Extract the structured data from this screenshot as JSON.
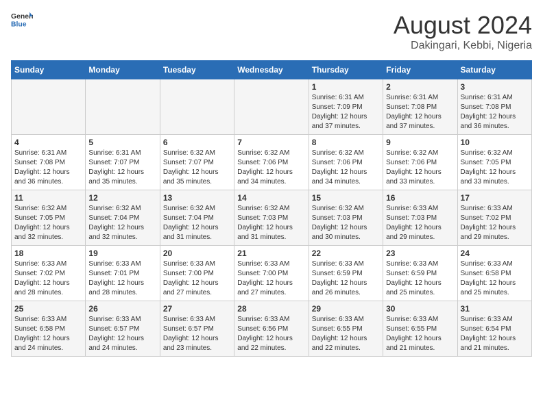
{
  "header": {
    "logo_general": "General",
    "logo_blue": "Blue",
    "month_year": "August 2024",
    "location": "Dakingari, Kebbi, Nigeria"
  },
  "days_of_week": [
    "Sunday",
    "Monday",
    "Tuesday",
    "Wednesday",
    "Thursday",
    "Friday",
    "Saturday"
  ],
  "weeks": [
    [
      {
        "day": "",
        "info": ""
      },
      {
        "day": "",
        "info": ""
      },
      {
        "day": "",
        "info": ""
      },
      {
        "day": "",
        "info": ""
      },
      {
        "day": "1",
        "info": "Sunrise: 6:31 AM\nSunset: 7:09 PM\nDaylight: 12 hours\nand 37 minutes."
      },
      {
        "day": "2",
        "info": "Sunrise: 6:31 AM\nSunset: 7:08 PM\nDaylight: 12 hours\nand 37 minutes."
      },
      {
        "day": "3",
        "info": "Sunrise: 6:31 AM\nSunset: 7:08 PM\nDaylight: 12 hours\nand 36 minutes."
      }
    ],
    [
      {
        "day": "4",
        "info": "Sunrise: 6:31 AM\nSunset: 7:08 PM\nDaylight: 12 hours\nand 36 minutes."
      },
      {
        "day": "5",
        "info": "Sunrise: 6:31 AM\nSunset: 7:07 PM\nDaylight: 12 hours\nand 35 minutes."
      },
      {
        "day": "6",
        "info": "Sunrise: 6:32 AM\nSunset: 7:07 PM\nDaylight: 12 hours\nand 35 minutes."
      },
      {
        "day": "7",
        "info": "Sunrise: 6:32 AM\nSunset: 7:06 PM\nDaylight: 12 hours\nand 34 minutes."
      },
      {
        "day": "8",
        "info": "Sunrise: 6:32 AM\nSunset: 7:06 PM\nDaylight: 12 hours\nand 34 minutes."
      },
      {
        "day": "9",
        "info": "Sunrise: 6:32 AM\nSunset: 7:06 PM\nDaylight: 12 hours\nand 33 minutes."
      },
      {
        "day": "10",
        "info": "Sunrise: 6:32 AM\nSunset: 7:05 PM\nDaylight: 12 hours\nand 33 minutes."
      }
    ],
    [
      {
        "day": "11",
        "info": "Sunrise: 6:32 AM\nSunset: 7:05 PM\nDaylight: 12 hours\nand 32 minutes."
      },
      {
        "day": "12",
        "info": "Sunrise: 6:32 AM\nSunset: 7:04 PM\nDaylight: 12 hours\nand 32 minutes."
      },
      {
        "day": "13",
        "info": "Sunrise: 6:32 AM\nSunset: 7:04 PM\nDaylight: 12 hours\nand 31 minutes."
      },
      {
        "day": "14",
        "info": "Sunrise: 6:32 AM\nSunset: 7:03 PM\nDaylight: 12 hours\nand 31 minutes."
      },
      {
        "day": "15",
        "info": "Sunrise: 6:32 AM\nSunset: 7:03 PM\nDaylight: 12 hours\nand 30 minutes."
      },
      {
        "day": "16",
        "info": "Sunrise: 6:33 AM\nSunset: 7:03 PM\nDaylight: 12 hours\nand 29 minutes."
      },
      {
        "day": "17",
        "info": "Sunrise: 6:33 AM\nSunset: 7:02 PM\nDaylight: 12 hours\nand 29 minutes."
      }
    ],
    [
      {
        "day": "18",
        "info": "Sunrise: 6:33 AM\nSunset: 7:02 PM\nDaylight: 12 hours\nand 28 minutes."
      },
      {
        "day": "19",
        "info": "Sunrise: 6:33 AM\nSunset: 7:01 PM\nDaylight: 12 hours\nand 28 minutes."
      },
      {
        "day": "20",
        "info": "Sunrise: 6:33 AM\nSunset: 7:00 PM\nDaylight: 12 hours\nand 27 minutes."
      },
      {
        "day": "21",
        "info": "Sunrise: 6:33 AM\nSunset: 7:00 PM\nDaylight: 12 hours\nand 27 minutes."
      },
      {
        "day": "22",
        "info": "Sunrise: 6:33 AM\nSunset: 6:59 PM\nDaylight: 12 hours\nand 26 minutes."
      },
      {
        "day": "23",
        "info": "Sunrise: 6:33 AM\nSunset: 6:59 PM\nDaylight: 12 hours\nand 25 minutes."
      },
      {
        "day": "24",
        "info": "Sunrise: 6:33 AM\nSunset: 6:58 PM\nDaylight: 12 hours\nand 25 minutes."
      }
    ],
    [
      {
        "day": "25",
        "info": "Sunrise: 6:33 AM\nSunset: 6:58 PM\nDaylight: 12 hours\nand 24 minutes."
      },
      {
        "day": "26",
        "info": "Sunrise: 6:33 AM\nSunset: 6:57 PM\nDaylight: 12 hours\nand 24 minutes."
      },
      {
        "day": "27",
        "info": "Sunrise: 6:33 AM\nSunset: 6:57 PM\nDaylight: 12 hours\nand 23 minutes."
      },
      {
        "day": "28",
        "info": "Sunrise: 6:33 AM\nSunset: 6:56 PM\nDaylight: 12 hours\nand 22 minutes."
      },
      {
        "day": "29",
        "info": "Sunrise: 6:33 AM\nSunset: 6:55 PM\nDaylight: 12 hours\nand 22 minutes."
      },
      {
        "day": "30",
        "info": "Sunrise: 6:33 AM\nSunset: 6:55 PM\nDaylight: 12 hours\nand 21 minutes."
      },
      {
        "day": "31",
        "info": "Sunrise: 6:33 AM\nSunset: 6:54 PM\nDaylight: 12 hours\nand 21 minutes."
      }
    ]
  ]
}
